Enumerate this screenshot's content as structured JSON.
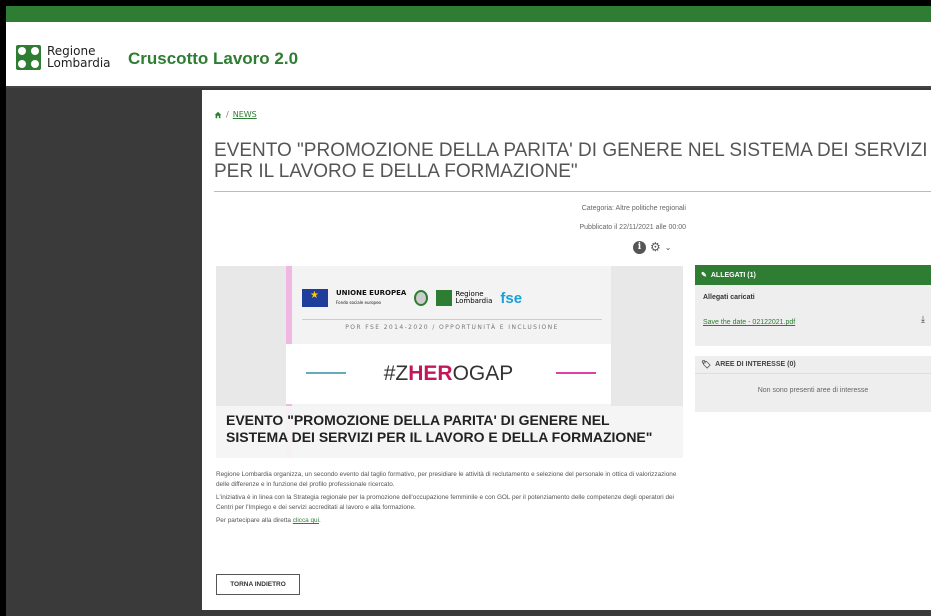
{
  "header": {
    "logo_text_line1": "Regione",
    "logo_text_line2": "Lombardia",
    "app_title": "Cruscotto Lavoro 2.0"
  },
  "breadcrumb": {
    "separator": "/",
    "current": "NEWS"
  },
  "article": {
    "title": "EVENTO \"PROMOZIONE DELLA PARITA' DI GENERE NEL SISTEMA DEI SERVIZI PER IL LAVORO E DELLA FORMAZIONE\"",
    "category": "Categoria: Altre politiche regionali",
    "published": "Pubblicato il 22/11/2021 alle 00:00",
    "hero": {
      "eu_label": "UNIONE EUROPEA",
      "eu_sub": "Fondo sociale europeo",
      "rl_label_1": "Regione",
      "rl_label_2": "Lombardia",
      "fse_label": "fse",
      "tagline": "POR FSE 2014-2020 / OPPORTUNITÀ E INCLUSIONE",
      "hashtag_pre": "#Z",
      "hashtag_hl": "HER",
      "hashtag_post": "OGAP",
      "caption": "EVENTO \"PROMOZIONE DELLA PARITA' DI GENERE NEL SISTEMA DEI SERVIZI PER IL LAVORO E DELLA FORMAZIONE\""
    },
    "paragraph1": "Regione Lombardia organizza, un secondo evento dal taglio formativo, per presidiare le attività di reclutamento e selezione del personale in ottica di valorizzazione delle differenze e in funzione del profilo professionale ricercato.",
    "paragraph2": "L'iniziativa è in linea con la Strategia regionale per la promozione dell'occupazione femminile e con GOL per il potenziamento delle competenze degli operatori dei Centri per l'Impiego e dei servizi accreditati al lavoro e alla formazione.",
    "paragraph3_pre": "Per partecipare alla diretta ",
    "paragraph3_link": "clicca qui",
    "paragraph3_post": ".",
    "back_label": "TORNA INDIETRO"
  },
  "attachments": {
    "header": "ALLEGATI (1)",
    "subtitle": "Allegati caricati",
    "file_name": "Save the date - 02122021.pdf"
  },
  "interests": {
    "header": "AREE DI INTERESSE (0)",
    "empty": "Non sono presenti aree di interesse"
  },
  "icons": [
    "home-icon",
    "info-icon",
    "gear-icon",
    "chevron-down-icon",
    "paperclip-icon",
    "download-icon",
    "tag-icon"
  ],
  "colors": {
    "brand_green": "#2e7d32",
    "highlight_pink": "#c2185b",
    "fse_blue": "#1aa0d8"
  }
}
